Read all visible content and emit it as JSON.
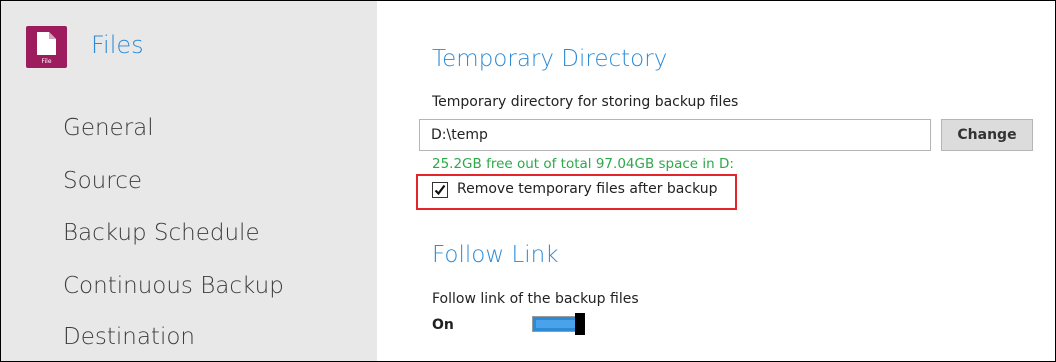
{
  "app": {
    "title": "Files",
    "icon": "file-icon",
    "icon_label": "File",
    "icon_color": "#9c1c5e"
  },
  "sidebar": {
    "items": [
      {
        "label": "General"
      },
      {
        "label": "Source"
      },
      {
        "label": "Backup Schedule"
      },
      {
        "label": "Continuous Backup"
      },
      {
        "label": "Destination"
      }
    ]
  },
  "temp_dir": {
    "section_title": "Temporary Directory",
    "field_label": "Temporary directory for storing backup files",
    "value": "D:\\temp",
    "change_label": "Change",
    "free_space": "25.2GB free out of total 97.04GB space in D:",
    "remove_checkbox": {
      "label": "Remove temporary files after backup",
      "checked": true
    }
  },
  "follow_link": {
    "section_title": "Follow Link",
    "field_label": "Follow link of the backup files",
    "state_label": "On",
    "enabled": true
  },
  "colors": {
    "accent": "#2d8bd6",
    "success_text": "#2ea84a",
    "highlight": "#e3242b",
    "sidebar_bg": "#e8e8e8"
  }
}
